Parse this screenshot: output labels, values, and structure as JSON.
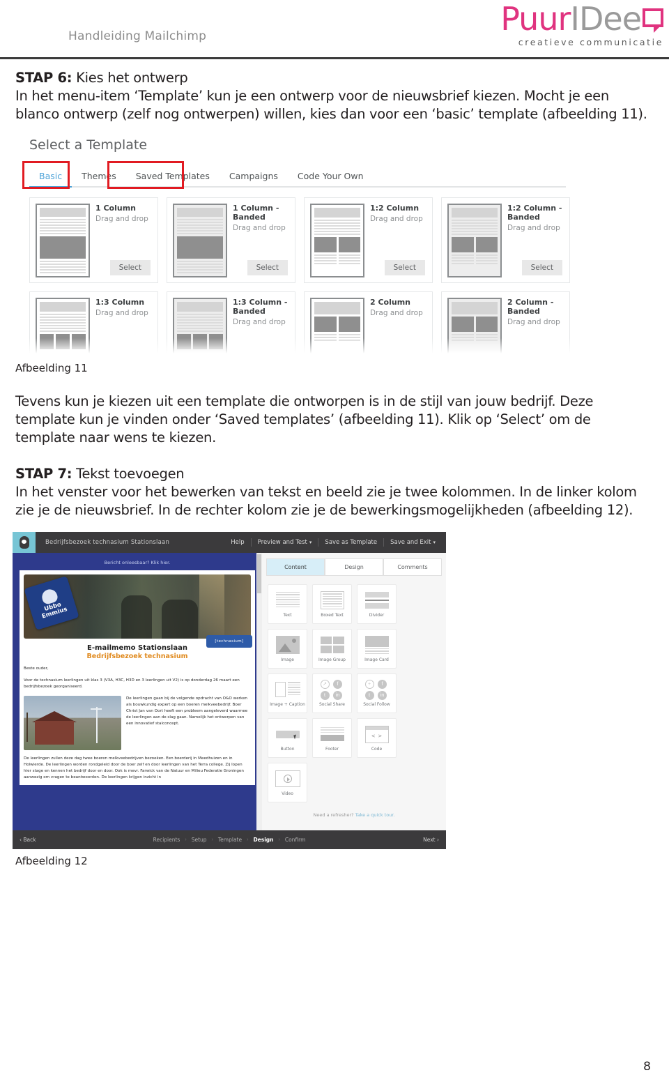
{
  "header": {
    "doc_title": "Handleiding Mailchimp",
    "logo": {
      "part1": "Puur",
      "part2": "IDee",
      "tagline": "creatieve communicatie",
      "brand_color": "#e0337f",
      "gray_color": "#9a9a9a"
    }
  },
  "steps": {
    "step6": {
      "label": "STAP 6:",
      "title": " Kies het ontwerp",
      "body": "In het menu-item ‘Template’ kun je een ontwerp voor de nieuwsbrief kiezen. Mocht je een blanco ontwerp (zelf nog ontwerpen) willen, kies dan voor een ‘basic’ template (afbeelding 11)."
    },
    "between": "Tevens kun je kiezen uit een template die ontworpen is in de stijl van jouw bedrijf. Deze template kun je vinden onder ‘Saved templates’ (afbeelding 11). Klik op ‘Select’ om de template naar wens te kiezen.",
    "step7": {
      "label": "STAP 7:",
      "title": " Tekst toevoegen",
      "body": "In het venster voor het bewerken van tekst en beeld zie je twee kolommen. In de linker kolom zie je de nieuwsbrief. In de rechter kolom zie je de bewerkingsmogelijkheden (afbeelding 12)."
    }
  },
  "captions": {
    "fig11": "Afbeelding 11",
    "fig12": "Afbeelding 12"
  },
  "figure11": {
    "title": "Select a Template",
    "tabs": [
      {
        "label": "Basic",
        "active": true,
        "highlighted": true
      },
      {
        "label": "Themes",
        "active": false,
        "highlighted": false
      },
      {
        "label": "Saved Templates",
        "active": false,
        "highlighted": true
      },
      {
        "label": "Campaigns",
        "active": false,
        "highlighted": false
      },
      {
        "label": "Code Your Own",
        "active": false,
        "highlighted": false
      }
    ],
    "select_label": "Select",
    "drag_label": "Drag and drop",
    "templates": [
      {
        "name": "1 Column",
        "sub": "Drag and drop",
        "banded": false,
        "layout": "one"
      },
      {
        "name": "1 Column - Banded",
        "sub": "Drag and drop",
        "banded": true,
        "layout": "one"
      },
      {
        "name": "1:2 Column",
        "sub": "Drag and drop",
        "banded": false,
        "layout": "two"
      },
      {
        "name": "1:2 Column - Banded",
        "sub": "Drag and drop",
        "banded": true,
        "layout": "two"
      },
      {
        "name": "1:3 Column",
        "sub": "Drag and drop",
        "banded": false,
        "layout": "three"
      },
      {
        "name": "1:3 Column - Banded",
        "sub": "Drag and drop",
        "banded": true,
        "layout": "three"
      },
      {
        "name": "2 Column",
        "sub": "Drag and drop",
        "banded": false,
        "layout": "twocol"
      },
      {
        "name": "2 Column - Banded",
        "sub": "Drag and drop",
        "banded": true,
        "layout": "twocol"
      }
    ]
  },
  "figure12": {
    "topbar": {
      "campaign_name": "Bedrijfsbezoek technasium Stationslaan",
      "actions": [
        {
          "label": "Help",
          "caret": false
        },
        {
          "label": "Preview and Test",
          "caret": true
        },
        {
          "label": "Save as Template",
          "caret": false
        },
        {
          "label": "Save and Exit",
          "caret": true
        }
      ]
    },
    "newsletter": {
      "unreadable": "Bericht onleesbaar? Klik hier.",
      "badge": {
        "line1": "Ubbo",
        "line2": "Emmius"
      },
      "tech_badge": "[technasium]",
      "title": "E-mailmemo Stationslaan",
      "subtitle": "Bedrijfsbezoek technasium",
      "greeting": "Beste ouder,",
      "intro": "Voor de technasium leerlingen uit klas 3 (V3A, H3C, H3D en 3 leerlingen uit V2) is op donderdag 26 maart een bedrijfsbezoek georganiseerd.",
      "column_text": "De leerlingen gaan bij de volgende opdracht van O&O werken als bouwkundig expert op een boeren melkveebedrijf. Boer Christ Jan van Oort heeft een probleem aangeleverd waarmee de leerlingen aan de slag gaan. Namelijk het ontwerpen van een innovatief stalconcept.",
      "body_text": "De leerlingen zullen deze dag twee boeren melkveebedrijven bezoeken. Een boerderij in Meedhuizen en in Holwierde. De leerlingen worden rondgeleid door de boer zelf en door leerlingen van het Terra college. Zij lopen hier stage en kennen het bedrijf door en door. Ook is mevr. Farwick van de Natuur en Milieu Federatie Groningen aanwezig om vragen te beantwoorden. De leerlingen krijgen inzicht in"
    },
    "panel_tabs": [
      {
        "label": "Content",
        "active": true
      },
      {
        "label": "Design",
        "active": false
      },
      {
        "label": "Comments",
        "active": false
      }
    ],
    "blocks": [
      {
        "label": "Text",
        "icon": "text-block-icon"
      },
      {
        "label": "Boxed Text",
        "icon": "boxed-text-block-icon"
      },
      {
        "label": "Divider",
        "icon": "divider-block-icon"
      },
      {
        "label": "Image",
        "icon": "image-block-icon"
      },
      {
        "label": "Image Group",
        "icon": "image-group-block-icon"
      },
      {
        "label": "Image Card",
        "icon": "image-card-block-icon"
      },
      {
        "label": "Image + Caption",
        "icon": "image-caption-block-icon"
      },
      {
        "label": "Social Share",
        "icon": "social-share-block-icon"
      },
      {
        "label": "Social Follow",
        "icon": "social-follow-block-icon"
      },
      {
        "label": "Button",
        "icon": "button-block-icon"
      },
      {
        "label": "Footer",
        "icon": "footer-block-icon"
      },
      {
        "label": "Code",
        "icon": "code-block-icon"
      },
      {
        "label": "Video",
        "icon": "video-block-icon"
      }
    ],
    "refresher": {
      "text": "Need a refresher? ",
      "link": "Take a quick tour."
    },
    "bottombar": {
      "back": "‹ Back",
      "next": "Next ›",
      "steps": [
        {
          "label": "Recipients",
          "current": false
        },
        {
          "label": "Setup",
          "current": false
        },
        {
          "label": "Template",
          "current": false
        },
        {
          "label": "Design",
          "current": true
        },
        {
          "label": "Confirm",
          "current": false
        }
      ],
      "separator": "›"
    }
  },
  "footer": {
    "page_number": "8"
  }
}
